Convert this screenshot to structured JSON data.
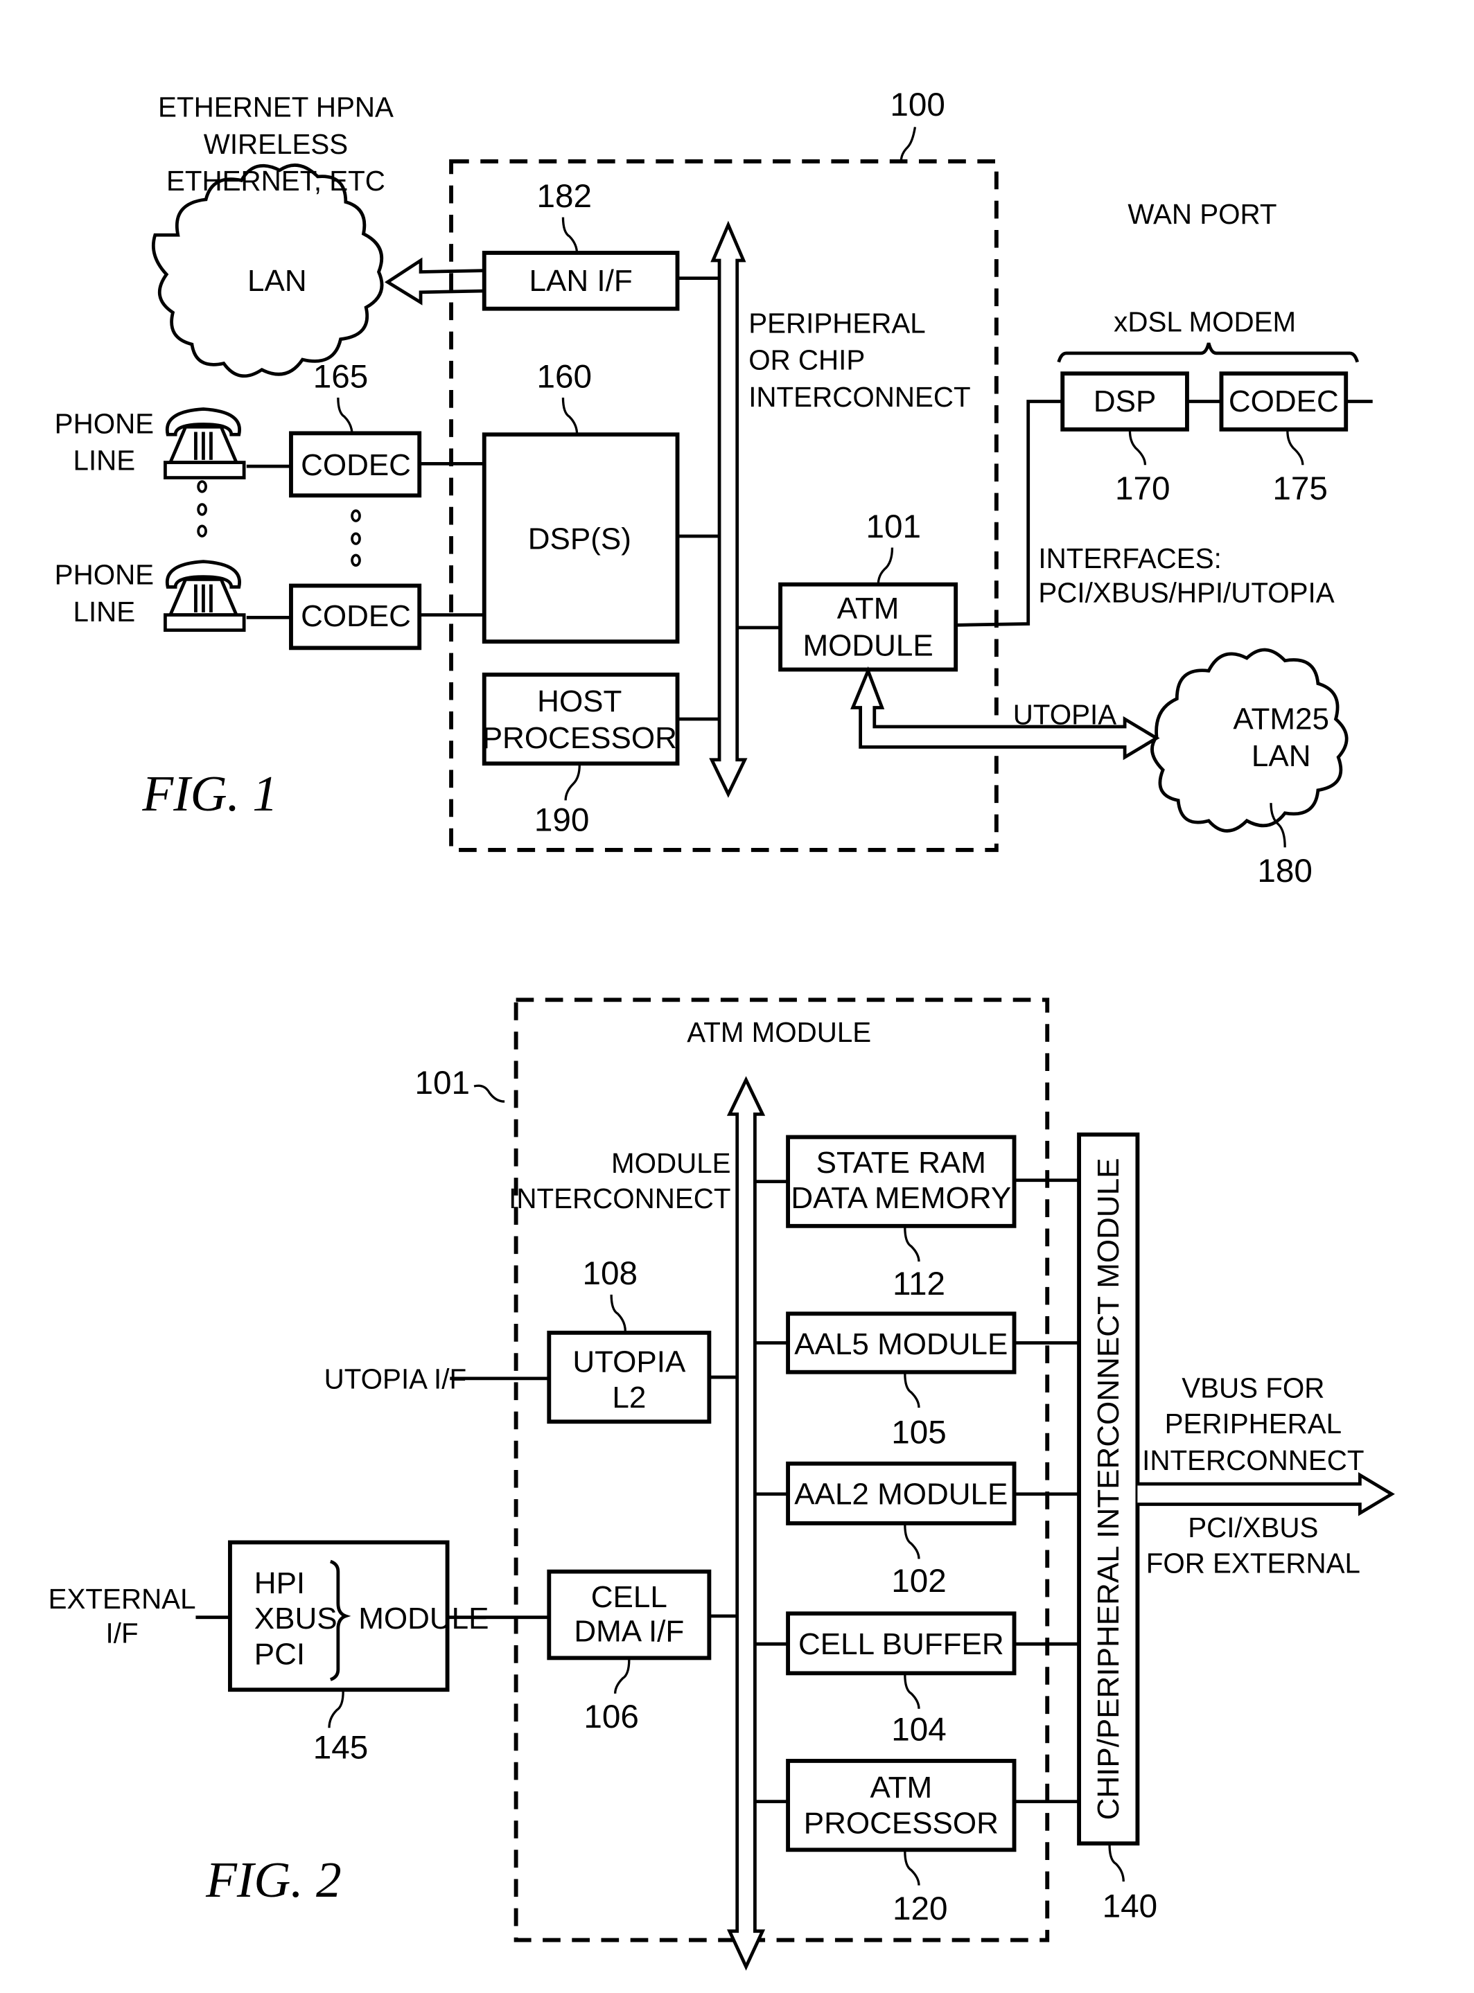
{
  "fig1": {
    "caption": "FIG.  1",
    "system_ref": "100",
    "lan_types": [
      "ETHERNET HPNA",
      "WIRELESS",
      "ETHERNET, ETC"
    ],
    "lan_cloud": "LAN",
    "lan_if": {
      "label": "LAN  I/F",
      "ref": "182"
    },
    "dsp": {
      "label": "DSP(S)",
      "ref": "160"
    },
    "host": {
      "lines": [
        "HOST",
        "PROCESSOR"
      ],
      "ref": "190"
    },
    "bus_label": [
      "PERIPHERAL",
      "OR  CHIP",
      "INTERCONNECT"
    ],
    "codec_ref": "165",
    "codec_label": "CODEC",
    "phone_label": [
      "PHONE",
      "LINE"
    ],
    "atm_module": {
      "lines": [
        "ATM",
        "MODULE"
      ],
      "ref": "101"
    },
    "wan_port": "WAN  PORT",
    "xdsl_modem": "xDSL  MODEM",
    "xdsl_dsp": {
      "label": "DSP",
      "ref": "170"
    },
    "xdsl_codec": {
      "label": "CODEC",
      "ref": "175"
    },
    "interfaces": [
      "INTERFACES:",
      "PCI/XBUS/HPI/UTOPIA"
    ],
    "utopia": "UTOPIA",
    "atm25": {
      "lines": [
        "ATM25",
        "LAN"
      ],
      "ref": "180"
    }
  },
  "fig2": {
    "caption": "FIG.  2",
    "title": "ATM  MODULE",
    "ref": "101",
    "bus_label": [
      "MODULE",
      "INTERCONNECT"
    ],
    "utopia_if": "UTOPIA  I/F",
    "utopia_l2": {
      "lines": [
        "UTOPIA",
        "L2"
      ],
      "ref": "108"
    },
    "cell_dma": {
      "lines": [
        "CELL",
        "DMA  I/F"
      ],
      "ref": "106"
    },
    "external_if": [
      "EXTERNAL",
      "I/F"
    ],
    "ext_module": {
      "items": [
        "HPI",
        "XBUS",
        "PCI"
      ],
      "label": "MODULE",
      "ref": "145"
    },
    "state_ram": {
      "lines": [
        "STATE  RAM",
        "DATA  MEMORY"
      ],
      "ref": "112"
    },
    "aal5": {
      "label": "AAL5  MODULE",
      "ref": "105"
    },
    "aal2": {
      "label": "AAL2  MODULE",
      "ref": "102"
    },
    "cell_buffer": {
      "label": "CELL  BUFFER",
      "ref": "104"
    },
    "atm_processor": {
      "lines": [
        "ATM",
        "PROCESSOR"
      ],
      "ref": "120"
    },
    "chip_interconnect": {
      "label": "CHIP/PERIPHERAL  INTERCONNECT  MODULE",
      "ref": "140"
    },
    "vbus": [
      "VBUS  FOR",
      "PERIPHERAL",
      "INTERCONNECT"
    ],
    "pci_xbus": [
      "PCI/XBUS",
      "FOR  EXTERNAL"
    ]
  }
}
